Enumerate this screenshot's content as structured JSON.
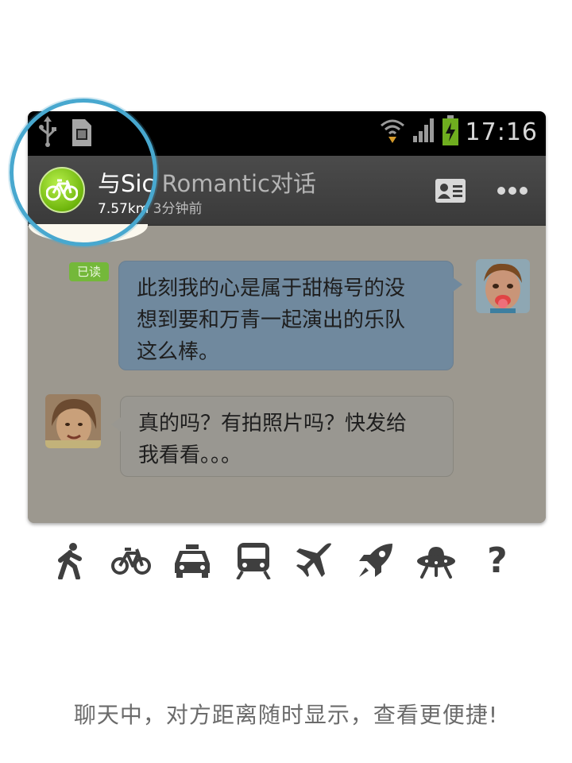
{
  "status_bar": {
    "time": "17:16",
    "icons": [
      "usb-icon",
      "sd-card-icon",
      "wifi-icon",
      "signal-icon",
      "battery-charging-icon"
    ]
  },
  "chat_header": {
    "name_bright": "与Sic",
    "name_dim": "Romantic对话",
    "distance": "7.57km",
    "time_ago": "3分钟前",
    "avatar_icon": "bicycle-icon",
    "actions": [
      "contact-card-icon",
      "more-icon"
    ]
  },
  "messages": [
    {
      "direction": "out",
      "status": "已读",
      "lines": [
        "此刻我的心是属于甜梅号的没",
        "想到要和万青一起演出的乐队",
        "这么棒。"
      ]
    },
    {
      "direction": "in",
      "lines": [
        "真的吗？有拍照片吗？快发给",
        "我看看。。。"
      ]
    }
  ],
  "transport_icons": [
    "walk-icon",
    "bicycle-icon",
    "car-icon",
    "train-icon",
    "airplane-icon",
    "rocket-icon",
    "ufo-icon",
    "question-icon"
  ],
  "transport_question": "?",
  "caption": "聊天中，对方距离随时显示，查看更便捷!",
  "colors": {
    "accent_ring": "#48a8cf",
    "bike_green": "#7cc217",
    "read_green": "#74b83a",
    "bubble_out": "#70899e",
    "bubble_in": "#999791"
  }
}
